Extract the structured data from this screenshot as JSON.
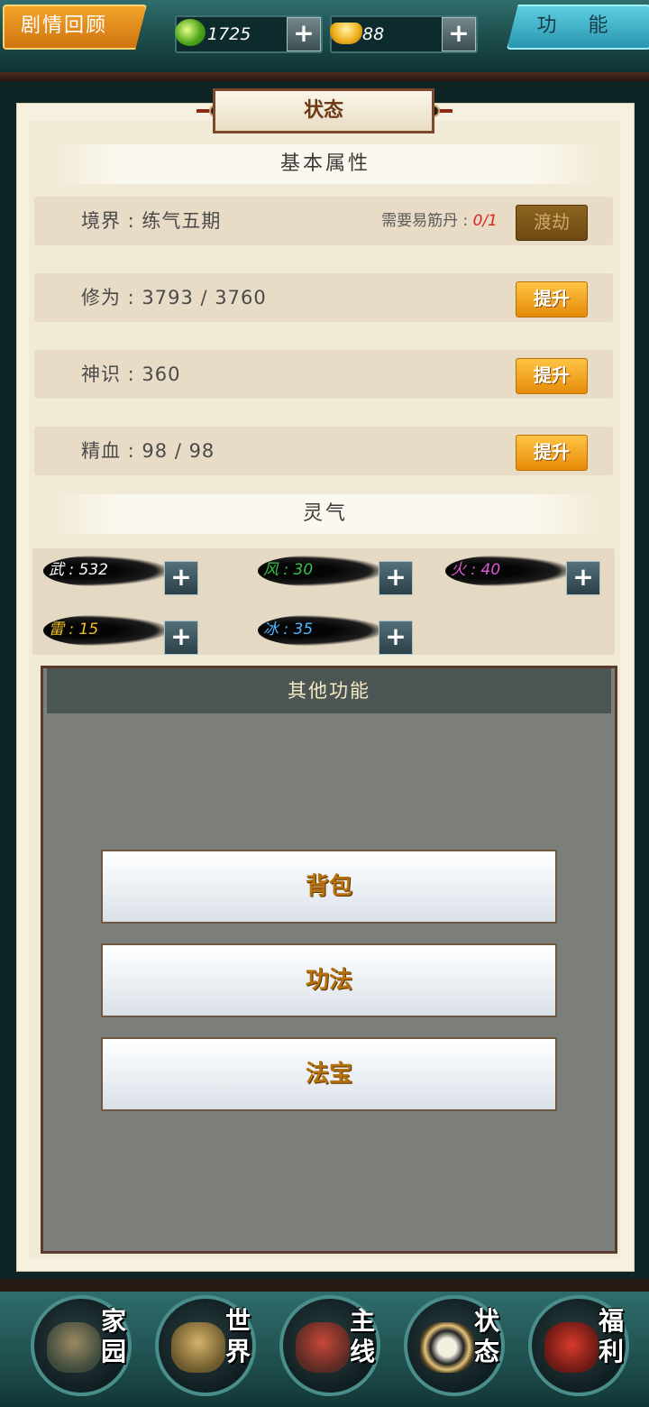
{
  "topbar": {
    "story_button": "剧情回顾",
    "function_button": "功 能",
    "jade_amount": "1725",
    "ingot_amount": "88",
    "add": "+"
  },
  "panel": {
    "title": "状态",
    "basic_section": "基本属性",
    "rows": [
      {
        "label": "境界 : 练气五期",
        "req_label": "需要易筋丹 : ",
        "req_value": "0/1",
        "button": "渡劫"
      },
      {
        "label": "修为 : 3793 / 3760",
        "button": "提升"
      },
      {
        "label": "神识 : 360",
        "button": "提升"
      },
      {
        "label": "精血 : 98 / 98",
        "button": "提升"
      }
    ],
    "lingqi_section": "灵气",
    "elements": [
      {
        "text": "武 : 532",
        "color": "#ffffff"
      },
      {
        "text": "风 : 30",
        "color": "#39c24a"
      },
      {
        "text": "火 : 40",
        "color": "#e05ad8"
      },
      {
        "text": "雷 : 15",
        "color": "#f0c020"
      },
      {
        "text": "冰 : 35",
        "color": "#4fb8ff"
      }
    ]
  },
  "other": {
    "title": "其他功能",
    "buttons": [
      "背包",
      "功法",
      "法宝"
    ]
  },
  "nav": [
    {
      "label": "家园",
      "icon": "home-icon"
    },
    {
      "label": "世界",
      "icon": "world-map-icon"
    },
    {
      "label": "主线",
      "icon": "main-quest-icon"
    },
    {
      "label": "状态",
      "icon": "bagua-icon"
    },
    {
      "label": "福利",
      "icon": "gift-bag-icon"
    }
  ]
}
